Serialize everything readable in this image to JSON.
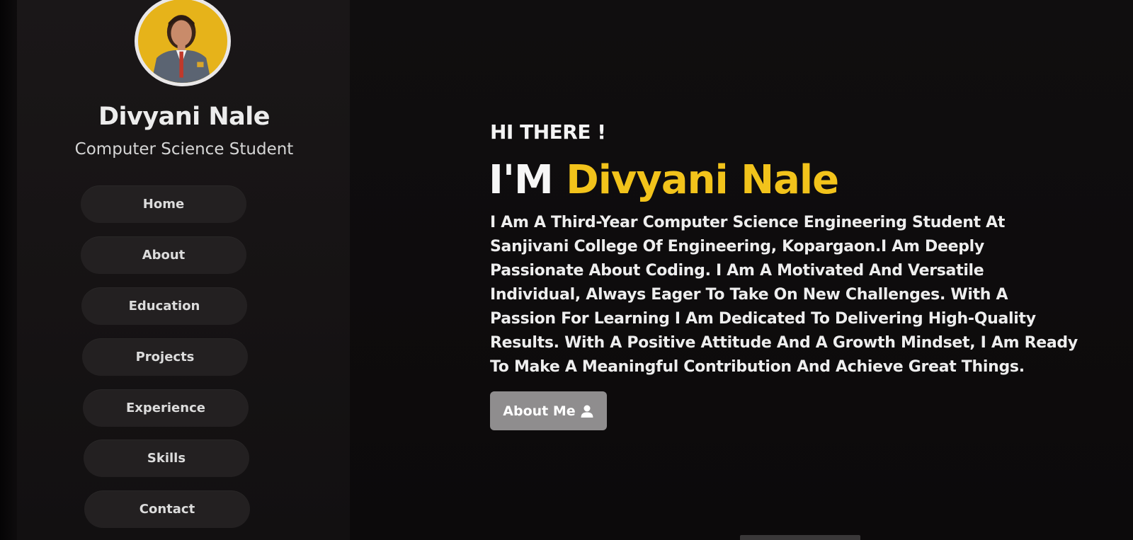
{
  "profile": {
    "name": "Divyani Nale",
    "title": "Computer Science Student",
    "avatar_colors": {
      "background": "#e6b31a",
      "border": "#e9e7e8"
    }
  },
  "nav": {
    "items": [
      {
        "label": "Home"
      },
      {
        "label": "About"
      },
      {
        "label": "Education"
      },
      {
        "label": "Projects"
      },
      {
        "label": "Experience"
      },
      {
        "label": "Skills"
      },
      {
        "label": "Contact"
      }
    ]
  },
  "hero": {
    "greeting": "HI THERE !",
    "headline_prefix": "I'M ",
    "headline_name": "Divyani Nale",
    "bio": "I Am A Third-Year Computer Science Engineering Student At Sanjivani College Of Engineering, Kopargaon.I Am Deeply Passionate About Coding. I Am A Motivated And Versatile Individual, Always Eager To Take On New Challenges. With A Passion For Learning I Am Dedicated To Delivering High-Quality Results. With A Positive Attitude And A Growth Mindset, I Am Ready To Make A Meaningful Contribution And Achieve Great Things.",
    "button_label": "About Me",
    "button_icon": "user-icon"
  },
  "colors": {
    "accent": "#f2c31b",
    "background": "#0c0a0b",
    "sidebar": "#171415",
    "nav_pill": "#232021",
    "button": "#8f8d8e"
  }
}
